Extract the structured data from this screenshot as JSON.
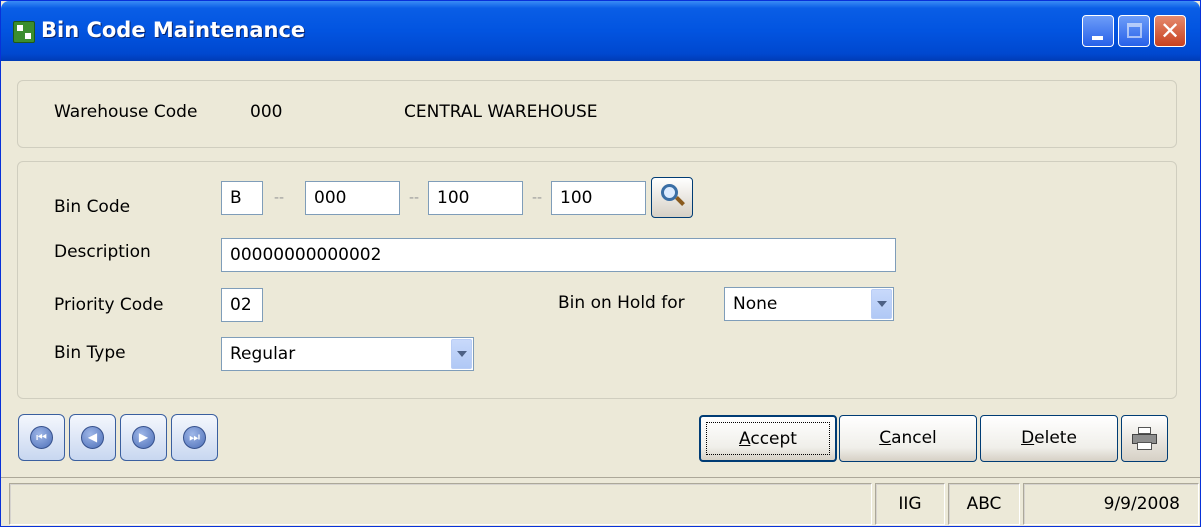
{
  "window": {
    "title": "Bin Code Maintenance",
    "app_icon": "mas90-app-icon"
  },
  "header": {
    "warehouse_code_label": "Warehouse Code",
    "warehouse_code_value": "000",
    "warehouse_name": "CENTRAL WAREHOUSE"
  },
  "form": {
    "bin_code_label": "Bin Code",
    "bin_code_segments": [
      "B",
      "000",
      "100",
      "100"
    ],
    "segment_separator": "--",
    "description_label": "Description",
    "description_value": "00000000000002",
    "priority_code_label": "Priority Code",
    "priority_code_value": "02",
    "bin_on_hold_label": "Bin on Hold for",
    "bin_on_hold_value": "None",
    "bin_type_label": "Bin Type",
    "bin_type_value": "Regular"
  },
  "buttons": {
    "accept_prefix": "A",
    "accept_rest": "ccept",
    "cancel_prefix": "C",
    "cancel_rest": "ancel",
    "delete_prefix": "D",
    "delete_rest": "elete"
  },
  "status": {
    "company": "IIG",
    "user": "ABC",
    "date": "9/9/2008"
  },
  "colors": {
    "title_bar": "#0254E0",
    "window_bg": "#ECE9D8",
    "field_border": "#7F9DB9"
  }
}
